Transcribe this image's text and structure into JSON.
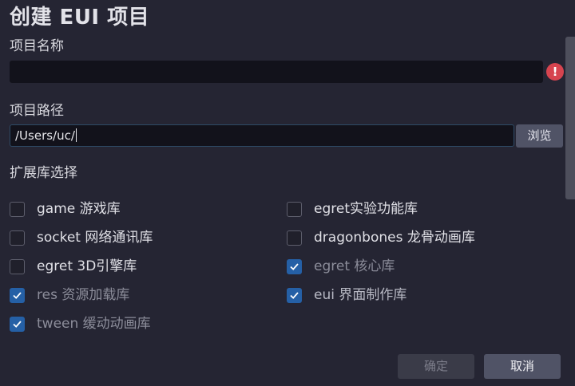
{
  "dialog": {
    "title": "创建 EUI 项目",
    "project_name": {
      "label": "项目名称",
      "value": "",
      "error_icon": "exclamation-icon",
      "error_glyph": "!"
    },
    "project_path": {
      "label": "项目路径",
      "value": "/Users/uc/",
      "browse_label": "浏览"
    },
    "extensions": {
      "label": "扩展库选择",
      "left": [
        {
          "label": "game 游戏库",
          "checked": false,
          "disabled": false
        },
        {
          "label": "socket 网络通讯库",
          "checked": false,
          "disabled": false
        },
        {
          "label": "egret 3D引擎库",
          "checked": false,
          "disabled": false
        },
        {
          "label": "res 资源加载库",
          "checked": true,
          "disabled": true
        },
        {
          "label": "tween 缓动动画库",
          "checked": true,
          "disabled": true
        }
      ],
      "right": [
        {
          "label": "egret实验功能库",
          "checked": false,
          "disabled": false
        },
        {
          "label": "dragonbones 龙骨动画库",
          "checked": false,
          "disabled": false
        },
        {
          "label": "egret 核心库",
          "checked": true,
          "disabled": true
        },
        {
          "label": "eui 界面制作库",
          "checked": true,
          "disabled": false
        }
      ]
    },
    "buttons": {
      "ok": "确定",
      "cancel": "取消"
    },
    "colors": {
      "background": "#252533",
      "checkbox_checked": "#2560a6",
      "error": "#d6444f",
      "button": "#505366"
    }
  }
}
